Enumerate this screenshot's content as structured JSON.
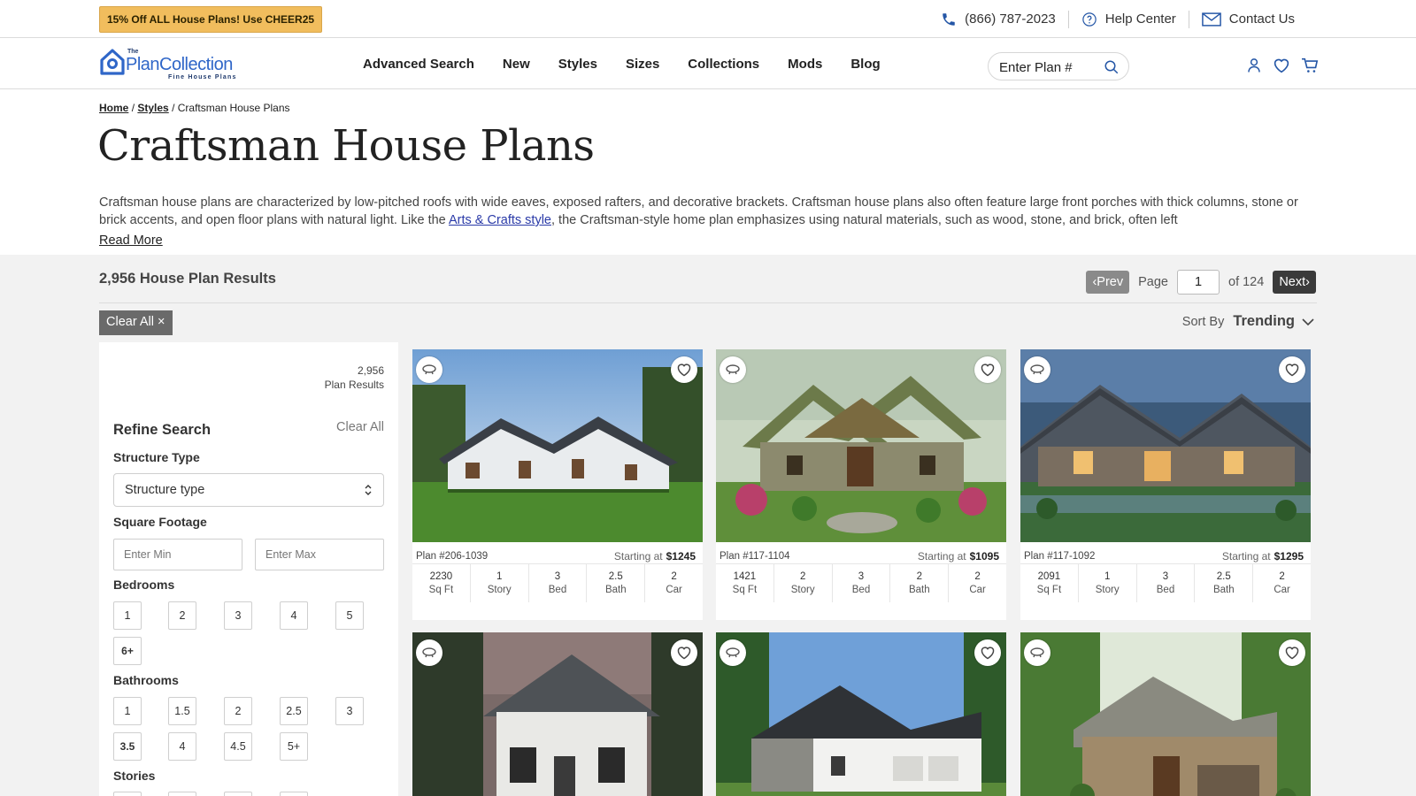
{
  "topbar": {
    "promo": "15% Off ALL House Plans! Use CHEER25",
    "phone": "(866) 787-2023",
    "help": "Help Center",
    "contact": "Contact Us"
  },
  "header": {
    "logo_the": "The",
    "logo_name": "PlanCollection",
    "logo_tag": "Fine House Plans",
    "nav": [
      "Advanced Search",
      "New",
      "Styles",
      "Sizes",
      "Collections",
      "Mods",
      "Blog"
    ],
    "search_placeholder": "Enter Plan #"
  },
  "breadcrumb": {
    "home": "Home",
    "styles": "Styles",
    "current": "Craftsman House Plans",
    "sep": "/"
  },
  "page": {
    "title": "Craftsman House Plans",
    "desc_1": "Craftsman house plans are characterized by low-pitched roofs with wide eaves, exposed rafters, and decorative brackets. Craftsman house plans also often feature large front porches with thick columns, stone or brick accents, and open floor plans with natural light. Like the ",
    "desc_link": "Arts & Crafts style",
    "desc_2": ", the Craftsman-style home plan emphasizes using natural materials, such as wood, stone, and brick, often left",
    "read_more": "Read More"
  },
  "results": {
    "count": "2,956 House Plan Results",
    "prev": "Prev",
    "page_label": "Page",
    "page_value": "1",
    "of": "of 124",
    "next": "Next",
    "clear_all": "Clear All",
    "sort_label": "Sort By",
    "sort_value": "Trending"
  },
  "sidebar": {
    "count_num": "2,956",
    "count_label": "Plan Results",
    "refine": "Refine Search",
    "clear": "Clear All",
    "structure_label": "Structure Type",
    "structure_value": "Structure type",
    "sqft_label": "Square Footage",
    "min_placeholder": "Enter Min",
    "max_placeholder": "Enter Max",
    "bed_label": "Bedrooms",
    "beds": [
      "1",
      "2",
      "3",
      "4",
      "5",
      "6+"
    ],
    "bath_label": "Bathrooms",
    "baths": [
      "1",
      "1.5",
      "2",
      "2.5",
      "3",
      "3.5",
      "4",
      "4.5",
      "5+"
    ],
    "stories_label": "Stories"
  },
  "cards": [
    {
      "plan": "Plan #206-1039",
      "starting": "Starting at",
      "price": "$1245",
      "stats": [
        [
          "2230",
          "Sq Ft"
        ],
        [
          "1",
          "Story"
        ],
        [
          "3",
          "Bed"
        ],
        [
          "2.5",
          "Bath"
        ],
        [
          "2",
          "Car"
        ]
      ]
    },
    {
      "plan": "Plan #117-1104",
      "starting": "Starting at",
      "price": "$1095",
      "stats": [
        [
          "1421",
          "Sq Ft"
        ],
        [
          "2",
          "Story"
        ],
        [
          "3",
          "Bed"
        ],
        [
          "2",
          "Bath"
        ],
        [
          "2",
          "Car"
        ]
      ]
    },
    {
      "plan": "Plan #117-1092",
      "starting": "Starting at",
      "price": "$1295",
      "stats": [
        [
          "2091",
          "Sq Ft"
        ],
        [
          "1",
          "Story"
        ],
        [
          "3",
          "Bed"
        ],
        [
          "2.5",
          "Bath"
        ],
        [
          "2",
          "Car"
        ]
      ]
    }
  ],
  "colors": {
    "promo": "#f1bd5d",
    "brand_blue": "#2f66c8",
    "next_btn": "#3a3a3a",
    "prev_btn": "#8a8a8a",
    "results_bg": "#f2f2f2"
  }
}
